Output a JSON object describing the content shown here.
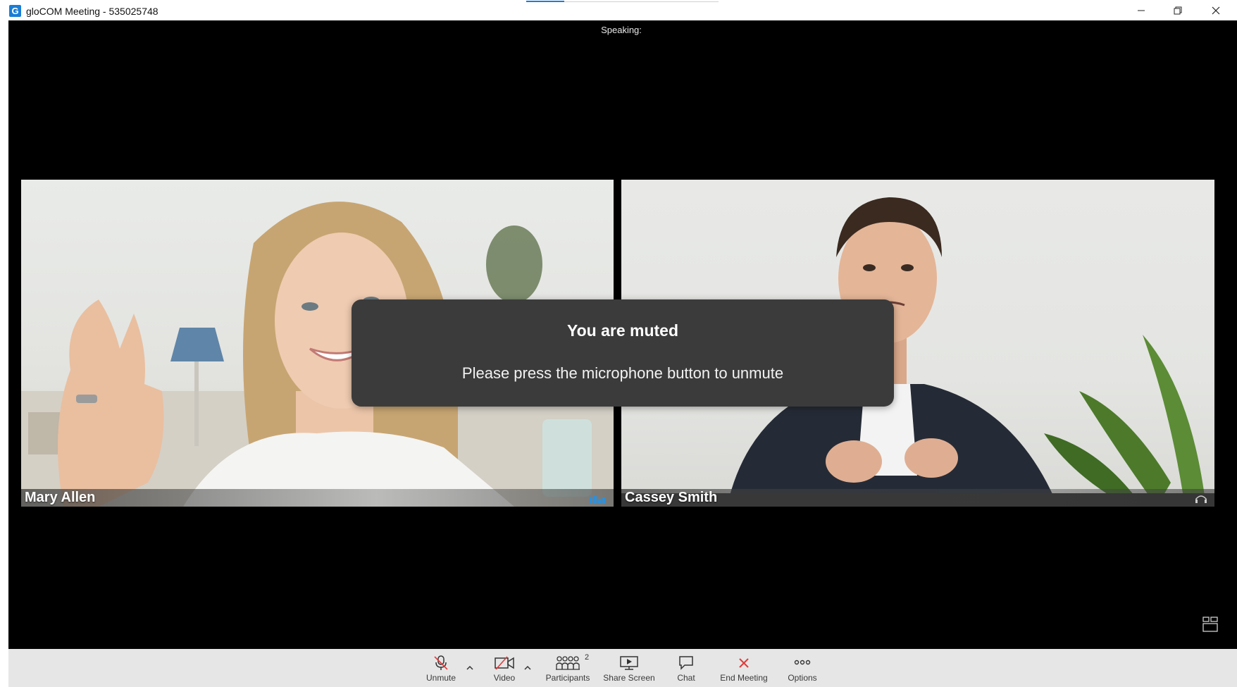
{
  "window": {
    "title": "gloCOM Meeting - 535025748",
    "logo_letter": "G",
    "controls": [
      "minimize-icon",
      "restore-icon",
      "close-icon"
    ]
  },
  "stage": {
    "speaking_label": "Speaking:"
  },
  "participants_tiles": [
    {
      "name": "Mary Allen",
      "indicator": "audio-level-icon"
    },
    {
      "name": "Cassey Smith",
      "indicator": "headset-icon"
    }
  ],
  "toast": {
    "title": "You are muted",
    "message": "Please press the microphone button to unmute"
  },
  "toolbar": {
    "unmute_label": "Unmute",
    "video_label": "Video",
    "participants_label": "Participants",
    "participants_count": "2",
    "share_label": "Share Screen",
    "chat_label": "Chat",
    "end_label": "End Meeting",
    "options_label": "Options"
  },
  "colors": {
    "accent": "#1a7dd6",
    "end_meeting": "#e03c3c",
    "audio_meter": "#2f8fd8",
    "toast_bg": "#3b3b3b"
  }
}
